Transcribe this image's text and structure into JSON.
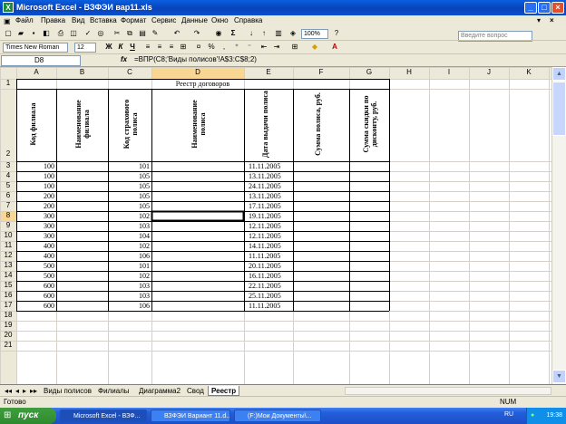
{
  "window": {
    "title": "Microsoft Excel - ВЗФЭИ вар11.xls",
    "icon": "X"
  },
  "menu": [
    "Файл",
    "Правка",
    "Вид",
    "Вставка",
    "Формат",
    "Сервис",
    "Данные",
    "Окно",
    "Справка"
  ],
  "help_placeholder": "Введите вопрос",
  "toolbar": {
    "zoom": "100%",
    "font": "Times New Roman",
    "size": "12",
    "bold": "Ж",
    "italic": "К",
    "underline": "Ч",
    "sigma": "Σ"
  },
  "formula_bar": {
    "cell": "D8",
    "fx": "fx",
    "formula": "=ВПР(C8;'Виды полисов'!A$3:C$8;2)"
  },
  "columns": [
    "A",
    "B",
    "C",
    "D",
    "E",
    "F",
    "G",
    "H",
    "I",
    "J",
    "K"
  ],
  "rows": [
    "1",
    "2",
    "3",
    "4",
    "5",
    "6",
    "7",
    "8",
    "9",
    "10",
    "11",
    "12",
    "13",
    "14",
    "15",
    "16",
    "17",
    "18",
    "19",
    "20",
    "21"
  ],
  "sheet": {
    "title": "Реестр договоров",
    "headers": [
      "Код филиала",
      "Наименование филиала",
      "Код страхового полиса",
      "Наименование полиса",
      "Дата выдачи полиса",
      "Сумма полиса, руб.",
      "Сумма скидки по дисконту, руб."
    ],
    "data": [
      [
        "100",
        "101",
        "11.11.2005"
      ],
      [
        "100",
        "105",
        "13.11.2005"
      ],
      [
        "100",
        "105",
        "24.11.2005"
      ],
      [
        "200",
        "105",
        "13.11.2005"
      ],
      [
        "200",
        "105",
        "17.11.2005"
      ],
      [
        "300",
        "102",
        "19.11.2005"
      ],
      [
        "300",
        "103",
        "12.11.2005"
      ],
      [
        "300",
        "104",
        "12.11.2005"
      ],
      [
        "400",
        "102",
        "14.11.2005"
      ],
      [
        "400",
        "106",
        "11.11.2005"
      ],
      [
        "500",
        "101",
        "20.11.2005"
      ],
      [
        "500",
        "102",
        "16.11.2005"
      ],
      [
        "600",
        "103",
        "22.11.2005"
      ],
      [
        "600",
        "103",
        "25.11.2005"
      ],
      [
        "600",
        "106",
        "11.11.2005"
      ]
    ]
  },
  "tabs": [
    "Виды полисов",
    "Филиалы",
    "Диаграмма2",
    "Свод",
    "Реестр"
  ],
  "active_tab": "Реестр",
  "status": {
    "left": "Готово",
    "num": "NUM"
  },
  "taskbar": {
    "start": "пуск",
    "tasks": [
      "Microsoft Excel - ВЗФ...",
      "ВЗФЭИ Вариант 11.d...",
      "(F:)Мои Документы\\..."
    ],
    "lang": "RU",
    "clock": "19:38"
  }
}
